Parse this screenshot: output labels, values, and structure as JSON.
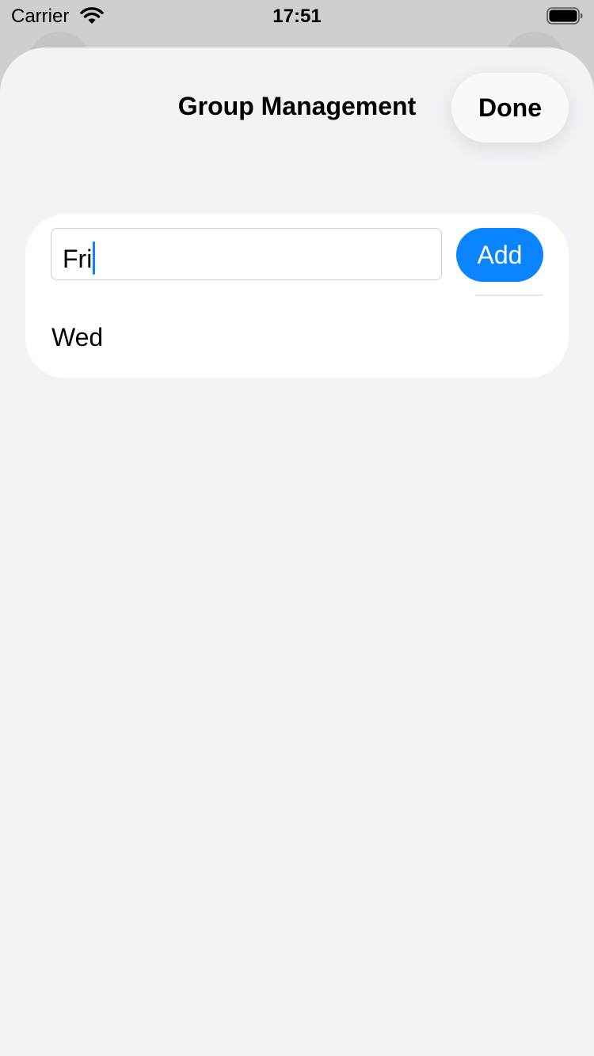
{
  "status_bar": {
    "carrier": "Carrier",
    "time": "17:51"
  },
  "nav": {
    "title": "Group Management",
    "done_label": "Done"
  },
  "form": {
    "input_value": "Fri",
    "add_label": "Add"
  },
  "groups": [
    {
      "name": "Wed"
    }
  ],
  "colors": {
    "accent": "#0a84ff",
    "sheet_background": "#f2f2f7",
    "card_background": "#ffffff"
  },
  "icons": {
    "wifi": "wifi-icon",
    "battery": "battery-icon"
  }
}
